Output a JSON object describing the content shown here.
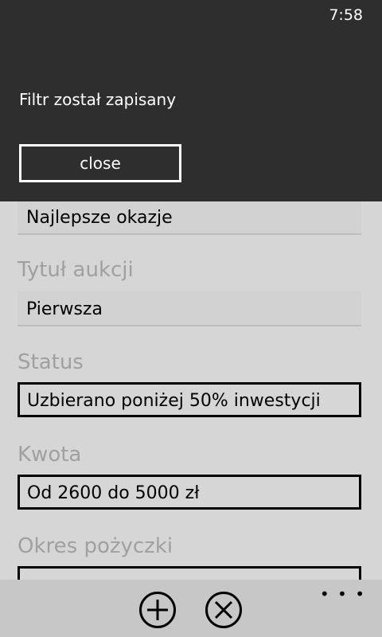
{
  "status_bar": {
    "time": "7:58"
  },
  "notification": {
    "message": "Filtr został zapisany",
    "close_label": "close"
  },
  "form": {
    "filter_name_value": "Najlepsze okazje",
    "auction_title_label": "Tytuł aukcji",
    "auction_title_value": "Pierwsza",
    "status_label": "Status",
    "status_value": "Uzbierano poniżej 50% inwestycji",
    "amount_label": "Kwota",
    "amount_value": "Od 2600 do 5000 zł",
    "loan_period_label": "Okres pożyczki"
  },
  "app_bar": {
    "icons": [
      "add-icon",
      "cancel-icon"
    ],
    "more_label": "• • •"
  }
}
